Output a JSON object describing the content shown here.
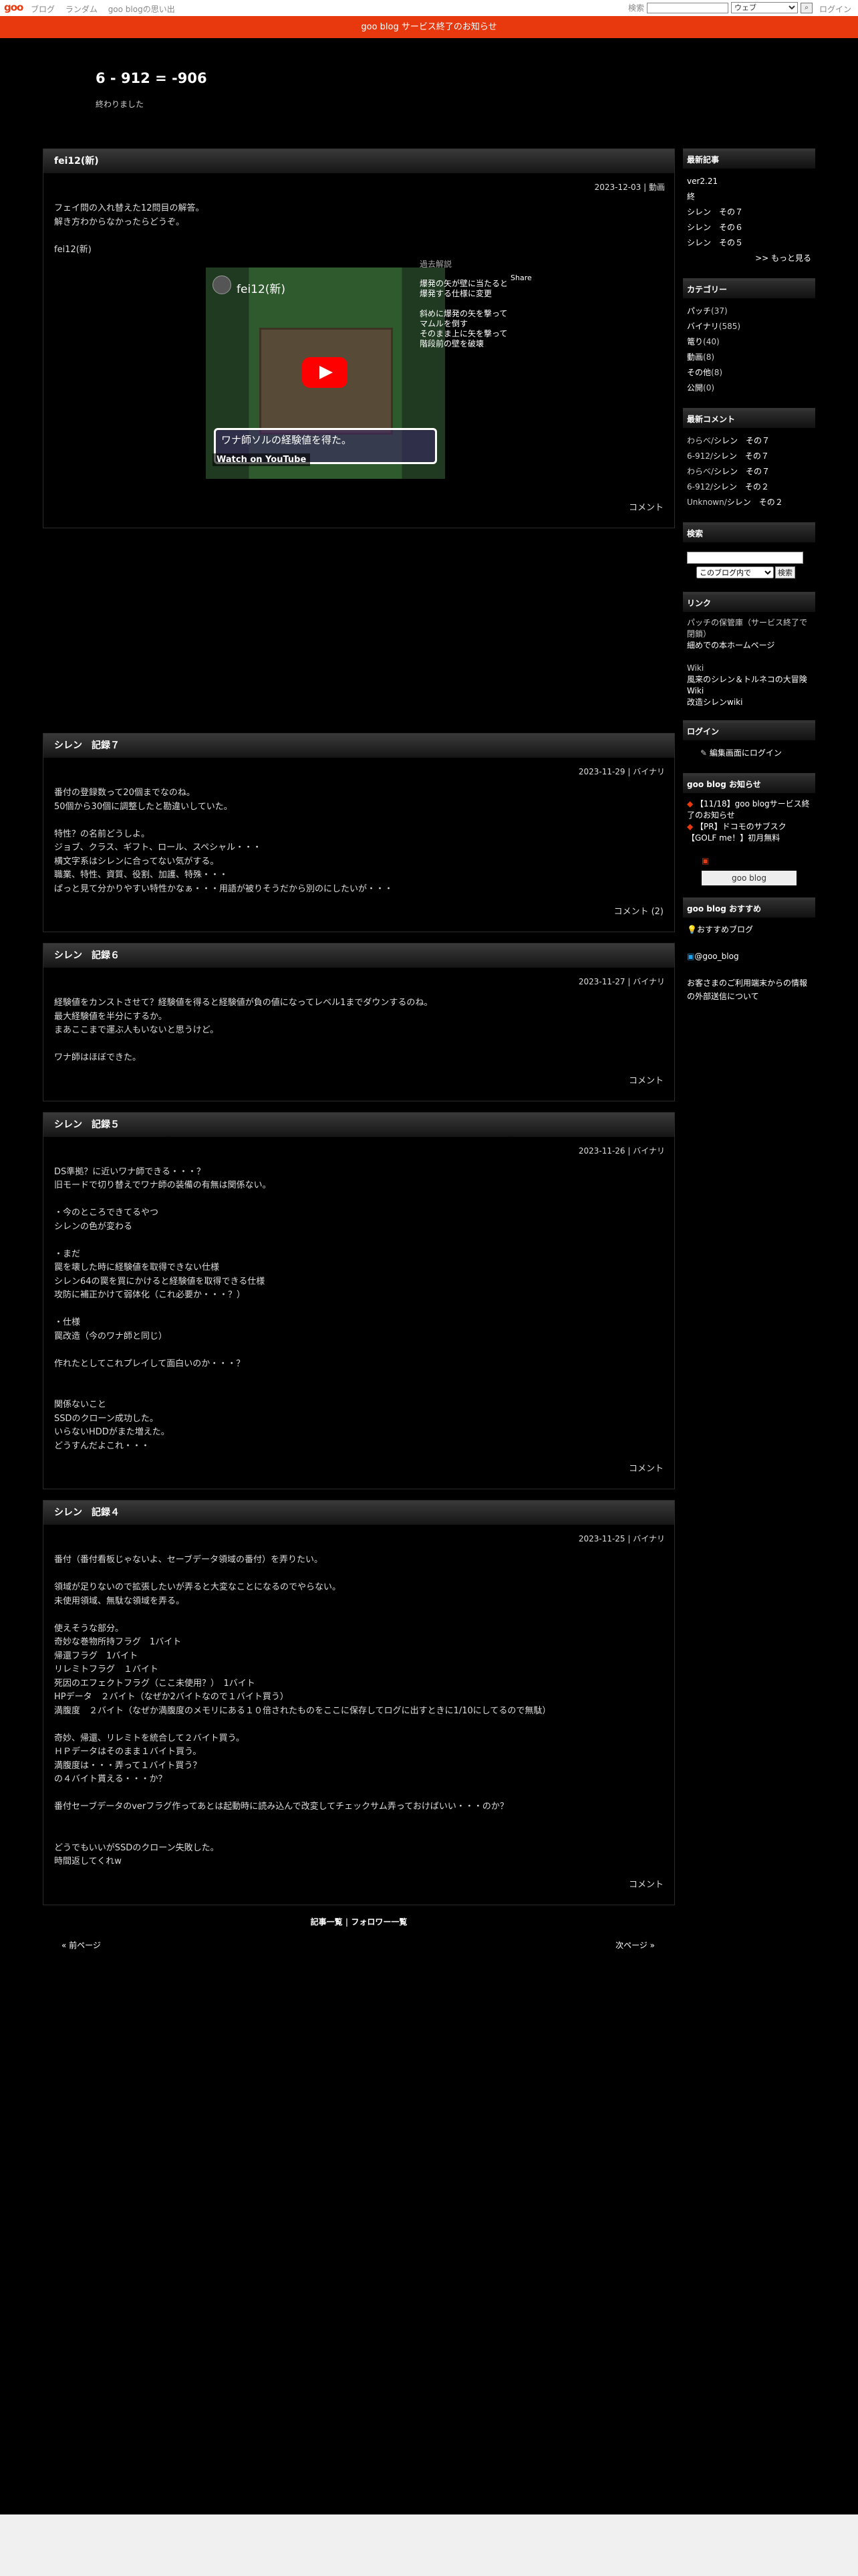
{
  "topbar": {
    "logo": "goo",
    "nav": [
      "ブログ",
      "ランダム",
      "goo blogの思い出"
    ],
    "search_label": "検索",
    "search_scope": "ウェブ",
    "login": "ログイン"
  },
  "notice": "goo blog サービス終了のお知らせ",
  "blog": {
    "title": "6 - 912 = -906",
    "description": "終わりました"
  },
  "entries": [
    {
      "title": "fei12(新)",
      "date": "2023-12-03 | 動画",
      "lines": [
        "フェイ問の入れ替えた12問目の解答。",
        "解き方わからなかったらどうぞ。",
        "",
        "fei12(新)"
      ],
      "footer": "コメント",
      "video": {
        "title": "fei12(新)",
        "side_heading": "過去解説",
        "side_lines": [
          "爆発の矢が壁に当たると",
          "爆発する仕様に変更",
          "",
          "斜めに爆発の矢を撃って",
          "マムルを倒す",
          "そのまま上に矢を撃って",
          "階段前の壁を破壊"
        ],
        "share": "Share",
        "msg": "ワナ師ソルの経験値を得た。",
        "watch": "Watch on YouTube"
      }
    },
    {
      "title": "シレン　記録７",
      "date": "2023-11-29 | バイナリ",
      "lines": [
        "番付の登録数って20個までなのね。",
        "50個から30個に調整したと勘違いしていた。",
        "",
        "特性？の名前どうしよ。",
        "ジョブ、クラス、ギフト、ロール、スペシャル・・・",
        "横文字系はシレンに合ってない気がする。",
        "職業、特性、資質、役割、加護、特殊・・・",
        "ぱっと見て分かりやすい特性かなぁ・・・用語が被りそうだから別のにしたいが・・・"
      ],
      "footer": "コメント (2)"
    },
    {
      "title": "シレン　記録６",
      "date": "2023-11-27 | バイナリ",
      "lines": [
        "経験値をカンストさせて？経験値を得ると経験値が負の値になってレベル1までダウンするのね。",
        "最大経験値を半分にするか。",
        "まあここまで運ぶ人もいないと思うけど。",
        "",
        "ワナ師はほぼできた。"
      ],
      "footer": "コメント"
    },
    {
      "title": "シレン　記録５",
      "date": "2023-11-26 | バイナリ",
      "lines": [
        "DS準拠？に近いワナ師できる・・・？",
        "旧モードで切り替えでワナ師の装備の有無は関係ない。",
        "",
        "・今のところできてるやつ",
        "シレンの色が変わる",
        "",
        "・まだ",
        "罠を壊した時に経験値を取得できない仕様",
        "シレン64の罠を買にかけると経験値を取得できる仕様",
        "攻防に補正かけて弱体化（これ必要か・・・？）",
        "",
        "・仕様",
        "罠改造（今のワナ師と同じ）",
        "",
        "作れたとしてこれプレイして面白いのか・・・？",
        "",
        "",
        "関係ないこと",
        "SSDのクローン成功した。",
        "いらないHDDがまた増えた。",
        "どうすんだよこれ・・・"
      ],
      "footer": "コメント"
    },
    {
      "title": "シレン　記録４",
      "date": "2023-11-25 | バイナリ",
      "lines": [
        "番付（番付看板じゃないよ、セーブデータ領域の番付）を弄りたい。",
        "",
        "領域が足りないので拡張したいが弄ると大変なことになるのでやらない。",
        "未使用領域、無駄な領域を弄る。",
        "",
        "使えそうな部分。",
        "奇妙な巻物所持フラグ　1バイト",
        "帰還フラグ　1バイト",
        "リレミトフラグ　１バイト",
        "死因のエフェクトフラグ（ここ未使用？）　1バイト",
        "HPデータ　２バイト（なぜか2バイトなので１バイト買う）",
        "満腹度　２バイト（なぜか満腹度のメモリにある１０倍されたものをここに保存してログに出すときに1/10にしてるので無駄）",
        "",
        "奇妙、帰還、リレミトを統合して２バイト買う。",
        "ＨＰデータはそのまま１バイト買う。",
        "満腹度は・・・弄って１バイト買う？",
        "の４バイト貰える・・・か？",
        "",
        "番付セーブデータのverフラグ作ってあとは起動時に読み込んで改変してチェックサム弄っておけばいい・・・のか？",
        "",
        "",
        "どうでもいいがSSDのクローン失敗した。",
        "時間返してくれw"
      ],
      "footer": "コメント"
    }
  ],
  "bottomlinks": {
    "list": "記事一覧",
    "sep": " | ",
    "follow": "フォロワー一覧"
  },
  "pager": {
    "prev": "« 前ページ",
    "next": "次ページ »"
  },
  "sidebar": {
    "recent_title": "最新記事",
    "recent": [
      "ver2.21",
      "終",
      "シレン　その７",
      "シレン　その６",
      "シレン　その５"
    ],
    "more": ">> もっと見る",
    "category_title": "カテゴリー",
    "categories": [
      {
        "name": "パッチ",
        "count": "(37)"
      },
      {
        "name": "バイナリ",
        "count": "(585)"
      },
      {
        "name": "篭り",
        "count": "(40)"
      },
      {
        "name": "動画",
        "count": "(8)"
      },
      {
        "name": "その他",
        "count": "(8)"
      },
      {
        "name": "公開",
        "count": "(0)"
      }
    ],
    "comments_title": "最新コメント",
    "comments": [
      {
        "who": "わらべ/",
        "link": "シレン　その７"
      },
      {
        "who": "6-912/",
        "link": "シレン　その７"
      },
      {
        "who": "わらべ/",
        "link": "シレン　その７"
      },
      {
        "who": "6-912/",
        "link": "シレン　その２"
      },
      {
        "who": "Unknown/",
        "link": "シレン　その２"
      }
    ],
    "search_title": "検索",
    "search_scope": "このブログ内で",
    "search_btn": "検索",
    "links_title": "リンク",
    "links": [
      "パッチの保管庫（サービス終了で閉鎖）",
      "細めでの本ホームページ"
    ],
    "wiki_label": "Wiki",
    "wiki_links": [
      "風来のシレン＆トルネコの大冒険 Wiki",
      "改造シレンwiki"
    ],
    "login_title": "ログイン",
    "login_link": "編集画面にログイン",
    "news_title": "goo blog お知らせ",
    "news": [
      "【11/18】goo blogサービス終了のお知らせ",
      "【PR】ドコモのサブスク【GOLF me！】初月無料"
    ],
    "goo_btn": "goo blog",
    "recommend_title": "goo blog おすすめ",
    "recommend": "おすすめブログ",
    "twitter": "@goo_blog",
    "external": "お客さまのご利用端末からの情報の外部送信について"
  }
}
